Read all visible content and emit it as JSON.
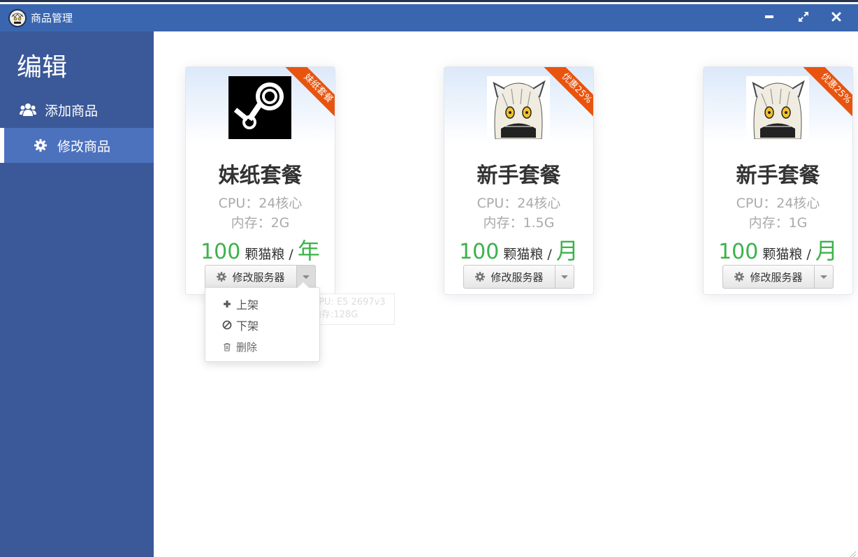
{
  "window": {
    "title": "商品管理",
    "minimize_icon": "minimize-icon",
    "maximize_icon": "expand-icon",
    "close_icon": "close-icon"
  },
  "sidebar": {
    "title": "编辑",
    "items": [
      {
        "label": "添加商品",
        "icon": "users-icon",
        "active": false
      },
      {
        "label": "修改商品",
        "icon": "gear-icon",
        "active": true
      }
    ]
  },
  "colors": {
    "titlebar": "#3a66b0",
    "sidebar": "#3b5999",
    "sidebar_active": "#4d72bd",
    "ribbon": "#e8540e",
    "price": "#3bb34a"
  },
  "cards": [
    {
      "name": "妹纸套餐",
      "ribbon": "妹纸套餐",
      "image": "steam-logo",
      "cpu": "CPU：24核心",
      "memory": "内存：2G",
      "price": "100",
      "unit": "颗猫粮 /",
      "period": "年",
      "button_label": "修改服务器"
    },
    {
      "name": "新手套餐",
      "ribbon": "优惠25%",
      "image": "anime-character",
      "cpu": "CPU：24核心",
      "memory": "内存：1.5G",
      "price": "100",
      "unit": "颗猫粮 /",
      "period": "月",
      "button_label": "修改服务器"
    },
    {
      "name": "新手套餐",
      "ribbon": "优惠25%",
      "image": "anime-character",
      "cpu": "CPU：24核心",
      "memory": "内存：1G",
      "price": "100",
      "unit": "颗猫粮 /",
      "period": "月",
      "button_label": "修改服务器"
    }
  ],
  "dropdown": {
    "items": [
      {
        "label": "上架",
        "icon": "plus-icon"
      },
      {
        "label": "下架",
        "icon": "ban-icon"
      },
      {
        "label": "删除",
        "icon": "trash-icon"
      }
    ]
  },
  "tooltip": {
    "line1": "CPU: E5 2697v3",
    "line2": "内存:128G"
  }
}
